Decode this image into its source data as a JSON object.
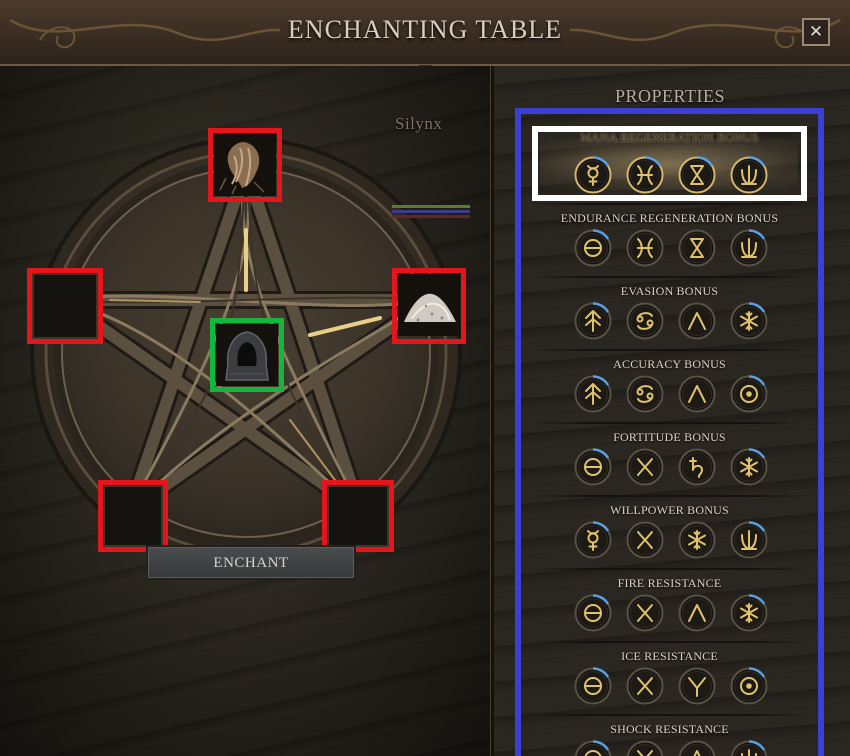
{
  "window": {
    "title": "ENCHANTING TABLE",
    "close_label": "✕"
  },
  "npc": {
    "name": "Silynx",
    "bar_colors": [
      "#5a7a2c",
      "#3b3c8c",
      "#5a2a2a"
    ]
  },
  "enchant_panel": {
    "enchant_label": "ENCHANT",
    "slots": [
      {
        "id": "top",
        "state": "filled",
        "item_icon": "root-bundle-icon",
        "marker": "red"
      },
      {
        "id": "left",
        "state": "empty",
        "item_icon": null,
        "marker": "red"
      },
      {
        "id": "right",
        "state": "filled",
        "item_icon": "powder-pile-icon",
        "marker": "red"
      },
      {
        "id": "bottom-left",
        "state": "empty",
        "item_icon": null,
        "marker": "red"
      },
      {
        "id": "bottom-right",
        "state": "empty",
        "item_icon": null,
        "marker": "red"
      },
      {
        "id": "center",
        "state": "filled",
        "item_icon": "hooded-cloak-icon",
        "marker": "green"
      }
    ]
  },
  "properties": {
    "header": "PROPERTIES",
    "selected_index": 0,
    "items": [
      {
        "label": "Mana Regeneration Bonus",
        "runes": [
          "mercury",
          "pisces",
          "hourglass",
          "trident"
        ]
      },
      {
        "label": "Endurance Regeneration Bonus",
        "runes": [
          "theta",
          "pisces",
          "hourglass",
          "trident"
        ]
      },
      {
        "label": "Evasion Bonus",
        "runes": [
          "arrow-up",
          "cancer",
          "caret",
          "snowflake"
        ]
      },
      {
        "label": "Accuracy Bonus",
        "runes": [
          "arrow-up",
          "cancer",
          "caret",
          "circled-dot"
        ]
      },
      {
        "label": "Fortitude Bonus",
        "runes": [
          "theta",
          "cross",
          "saturn",
          "snowflake"
        ]
      },
      {
        "label": "Willpower Bonus",
        "runes": [
          "mercury",
          "cross",
          "snowflake",
          "trident"
        ]
      },
      {
        "label": "Fire Resistance",
        "runes": [
          "theta",
          "cross",
          "caret",
          "snowflake"
        ]
      },
      {
        "label": "Ice Resistance",
        "runes": [
          "theta",
          "cross",
          "y-rune",
          "circled-dot"
        ]
      },
      {
        "label": "Shock Resistance",
        "runes": [
          "theta",
          "cross",
          "caret",
          "trident"
        ]
      }
    ]
  },
  "colors": {
    "slot_marker_red": "#e4151b",
    "slot_marker_green": "#12b83c",
    "properties_frame_blue": "#3b3fd2",
    "selected_frame_white": "#ffffff",
    "rune_gold": "#e0c26a"
  }
}
